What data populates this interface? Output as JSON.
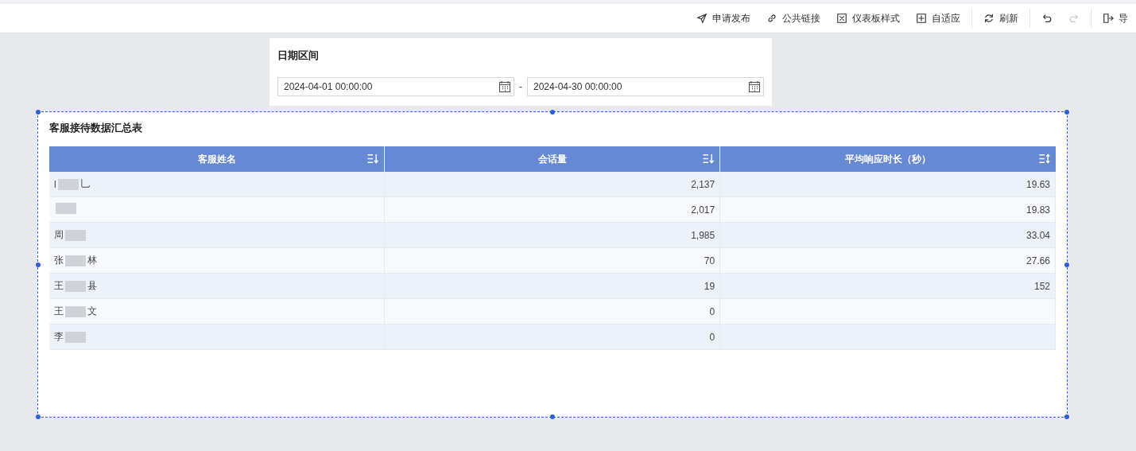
{
  "toolbar": {
    "items": [
      {
        "kind": "send",
        "label": "申请发布"
      },
      {
        "kind": "link",
        "label": "公共链接"
      },
      {
        "kind": "style",
        "label": "仪表板样式"
      },
      {
        "kind": "fit",
        "label": "自适应"
      },
      {
        "kind": "refresh",
        "label": "刷新",
        "divider": true
      },
      {
        "kind": "undo",
        "disabled": false,
        "divider": true
      },
      {
        "kind": "redo",
        "disabled": true
      },
      {
        "kind": "export",
        "label": "导",
        "divider": true
      }
    ]
  },
  "date_filter": {
    "title": "日期区间",
    "start": "2024-04-01 00:00:00",
    "separator": "-",
    "end": "2024-04-30 00:00:00"
  },
  "table_widget": {
    "title": "客服接待数据汇总表",
    "selected": true,
    "columns": [
      {
        "label": "客服姓名",
        "kind": "descending"
      },
      {
        "label": "会话量",
        "kind": "descending"
      },
      {
        "label": "平均响应时长（秒）",
        "kind": "sortable"
      }
    ],
    "rows": [
      {
        "name_parts": [
          "l",
          "乚"
        ],
        "sessions": "2,137",
        "avg": "19.63"
      },
      {
        "sessions": "2,017",
        "avg": "19.83"
      },
      {
        "name_parts": [
          "周"
        ],
        "sessions": "1,985",
        "avg": "33.04"
      },
      {
        "name_parts": [
          "张",
          "林"
        ],
        "sessions": "70",
        "avg": "27.66"
      },
      {
        "name_parts": [
          "王",
          "县"
        ],
        "sessions": "19",
        "avg": "152"
      },
      {
        "name_parts": [
          "王",
          "文"
        ],
        "sessions": "0"
      },
      {
        "name_parts": [
          "李"
        ],
        "sessions": "0"
      }
    ]
  }
}
